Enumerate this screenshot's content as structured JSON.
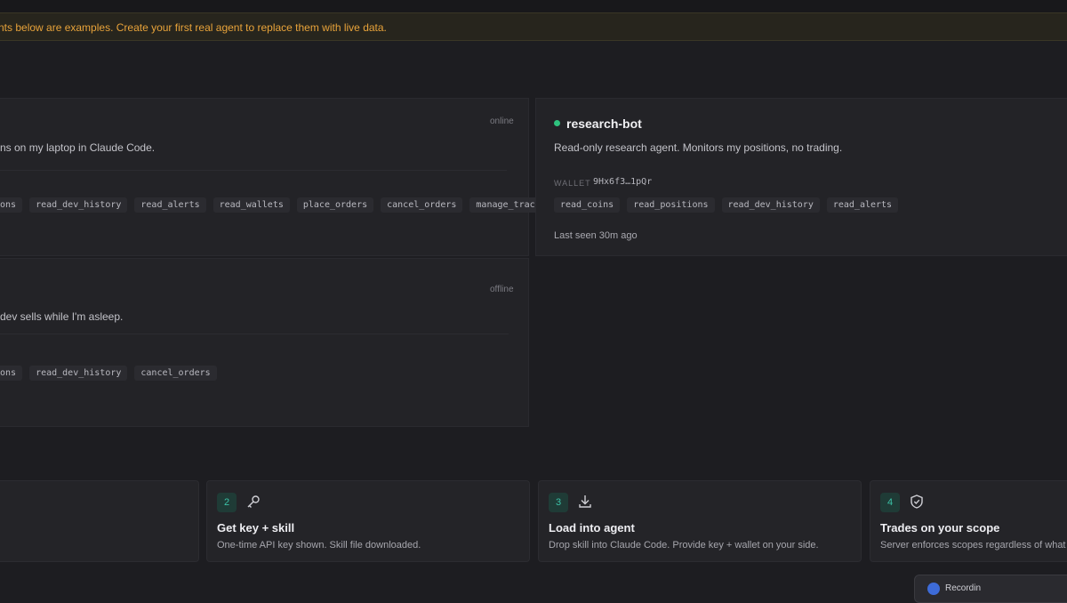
{
  "banner": {
    "text": "nts below are examples. Create your first real agent to replace them with live data."
  },
  "agents": [
    {
      "status": "online",
      "description": "ns on my laptop in Claude Code.",
      "tags": [
        "ons",
        "read_dev_history",
        "read_alerts",
        "read_wallets",
        "place_orders",
        "cancel_orders",
        "manage_tracking"
      ]
    },
    {
      "name": "research-bot",
      "status_color": "#2ec27e",
      "description": "Read-only research agent. Monitors my positions, no trading.",
      "wallet_label": "WALLET",
      "wallet": "9Hx6f3…1pQr",
      "tags": [
        "read_coins",
        "read_positions",
        "read_dev_history",
        "read_alerts"
      ],
      "last_seen": "Last seen 30m ago"
    },
    {
      "status": "offline",
      "description": "dev sells while I'm asleep.",
      "tags": [
        "ons",
        "read_dev_history",
        "cancel_orders"
      ]
    }
  ],
  "steps": [
    {
      "number": "2",
      "icon": "key-icon",
      "title": "Get key + skill",
      "description": "One-time API key shown. Skill file downloaded."
    },
    {
      "number": "3",
      "icon": "download-icon",
      "title": "Load into agent",
      "description": "Drop skill into Claude Code. Provide key + wallet on your side."
    },
    {
      "number": "4",
      "icon": "shield-check-icon",
      "title": "Trades on your scope",
      "description": "Server enforces scopes regardless of what a"
    }
  ],
  "recording": {
    "label": "Recordin"
  },
  "colors": {
    "accent": "#3cc2a7",
    "warning": "#e8a33a",
    "online": "#2ec27e"
  }
}
